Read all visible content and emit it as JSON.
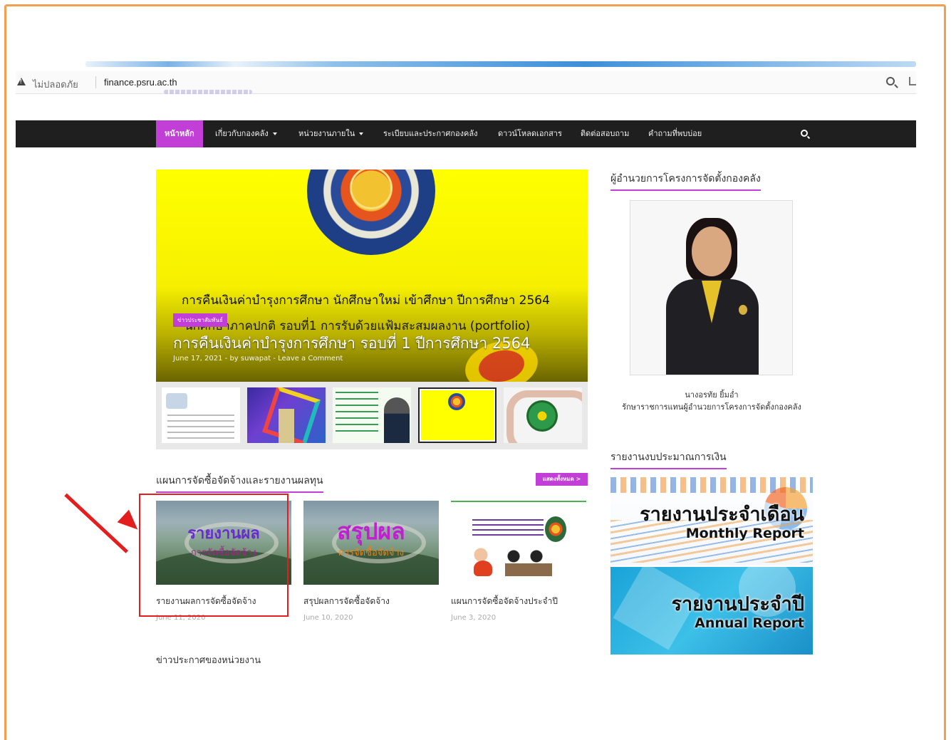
{
  "browser": {
    "security_label": "ไม่ปลอดภัย",
    "url": "finance.psru.ac.th"
  },
  "nav": {
    "items": [
      {
        "label": "หน้าหลัก",
        "active": true
      },
      {
        "label": "เกี่ยวกับกองคลัง",
        "dropdown": true
      },
      {
        "label": "หน่วยงานภายใน",
        "dropdown": true
      },
      {
        "label": "ระเบียบและประกาศกองคลัง"
      },
      {
        "label": "ดาวน์โหลดเอกสาร"
      },
      {
        "label": "ติดต่อสอบถาม"
      },
      {
        "label": "คำถามที่พบบ่อย"
      }
    ],
    "search_icon": "search-icon"
  },
  "hero": {
    "line1": "การคืนเงินค่าบำรุงการศึกษา นักศึกษาใหม่ เข้าศึกษา ปีการศึกษา 2564",
    "line2": "นักศึกษาภาคปกติ รอบที่1 การรับด้วยแฟ้มสะสมผลงาน (portfolio)",
    "badge": "ข่าวประชาสัมพันธ์",
    "title": "การคืนเงินค่าบำรุงการศึกษา รอบที่ 1 ปีการศึกษา 2564",
    "meta": "June 17, 2021 - by suwapat - Leave a Comment"
  },
  "procurement": {
    "heading": "แผนการจัดซื้อจัดจ้างและรายงานผลทุน",
    "view_all": "แสดงทั้งหมด >",
    "cards": [
      {
        "banner_big": "รายงานผล",
        "banner_small": "การจัดซื้อจัดจ้าง",
        "title": "รายงานผลการจัดซื้อจัดจ้าง",
        "date": "June 11, 2020"
      },
      {
        "banner_big": "สรุปผล",
        "banner_small": "การจัดซื้อจัดจ้าง",
        "title": "สรุปผลการจัดซื้อจัดจ้าง",
        "date": "June 10, 2020"
      },
      {
        "title": "แผนการจัดซื้อจัดจ้างประจำปี",
        "date": "June 3, 2020"
      }
    ]
  },
  "news_heading": "ข่าวประกาศของหน่วยงาน",
  "sidebar": {
    "director_heading": "ผู้อำนวยการโครงการจัดตั้งกองคลัง",
    "director_name": "นางอรทัย ยิ้มอ่ำ",
    "director_role": "รักษาราชการแทนผู้อำนวยการโครงการจัดตั้งกองคลัง",
    "report_heading": "รายงานงบประมาณการเงิน",
    "monthly_th": "รายงานประจำเดือน",
    "monthly_en": "Monthly Report",
    "annual_th": "รายงานประจำปี",
    "annual_en": "Annual Report"
  },
  "colors": {
    "accent": "#c13fd6",
    "nav_bg": "#1f1f1f",
    "highlight": "#e41e1e",
    "frame": "#f0a050"
  }
}
